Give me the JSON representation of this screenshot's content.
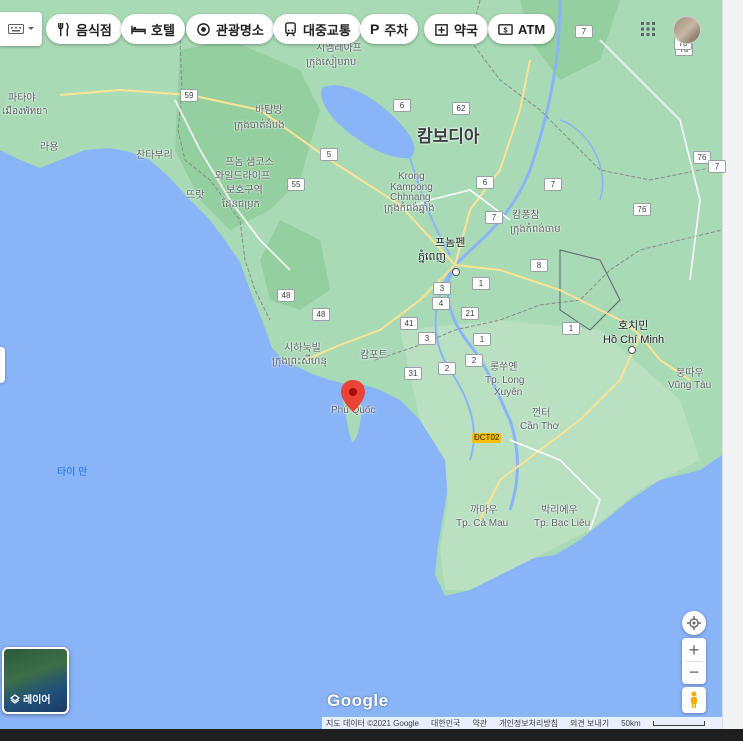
{
  "chips": [
    {
      "label": "음식점",
      "icon": "fork-knife-icon"
    },
    {
      "label": "호텔",
      "icon": "bed-icon"
    },
    {
      "label": "관광명소",
      "icon": "camera-icon"
    },
    {
      "label": "대중교통",
      "icon": "train-icon"
    },
    {
      "label": "주차",
      "icon": "parking-icon"
    },
    {
      "label": "약국",
      "icon": "pharmacy-icon"
    },
    {
      "label": "ATM",
      "icon": "atm-icon"
    }
  ],
  "map_labels": {
    "country": "캄보디아",
    "siem_reap_ko": "시엠레아프",
    "siem_reap_km": "ក្រុងសៀមរាប",
    "pattaya_ko": "파타야",
    "pattaya_th": "เมืองพัทยา",
    "rayong": "라용",
    "chanthaburi": "찬타부리",
    "trat": "뜨랏",
    "battambang_ko": "바탐방",
    "battambang_km": "ក្រុងបាត់ដំបង",
    "phnom_samkos_1": "프놈 샘코스",
    "phnom_samkos_2": "와일드라이프",
    "phnom_samkos_3": "보호구역",
    "phnom_samkos_km": "ដែនជម្រក",
    "kampong_chhnang_1": "Krong",
    "kampong_chhnang_2": "Kampong",
    "kampong_chhnang_3": "Chhnang",
    "kampong_chhnang_km": "ក្រុងកំពង់ឆ្នាំង",
    "kampong_cham_ko": "캄퐁참",
    "kampong_cham_km": "ក្រុងកំពង់ចាម",
    "phnom_penh_ko": "프놈펜",
    "phnom_penh_km": "ភ្នំពេញ",
    "sihanoukville_ko": "시하눅빌",
    "sihanoukville_km": "ក្រុងព្រះសីហនុ",
    "kampot": "캄포트",
    "hcmc_ko": "호치민",
    "hcmc_vi": "Hồ Chí Minh",
    "vung_tau_ko": "붕따우",
    "vung_tau_vi": "Vũng Tàu",
    "long_xuyen_ko": "롱쑤옌",
    "long_xuyen_vi_1": "Tp. Long",
    "long_xuyen_vi_2": "Xuyên",
    "can_tho_ko": "껀터",
    "can_tho_vi": "Cần Thơ",
    "ca_mau_ko": "까마우",
    "ca_mau_vi": "Tp. Cà Mau",
    "bac_lieu_ko": "박리에우",
    "bac_lieu_vi": "Tp. Bạc Liêu",
    "phu_quoc": "Phú Quốc",
    "gulf_thailand": "타이 만"
  },
  "shields": [
    "7",
    "78",
    "59",
    "6",
    "62",
    "5",
    "55",
    "6",
    "7",
    "76",
    "76",
    "7",
    "8",
    "3",
    "1",
    "48",
    "4",
    "21",
    "1",
    "41",
    "3",
    "2",
    "31",
    "2",
    "1",
    "48",
    "78",
    "7"
  ],
  "layers_label": "레이어",
  "google_logo": "Google",
  "footer": {
    "map_data": "지도 데이터 ©2021 Google",
    "region": "대한민국",
    "terms": "약관",
    "privacy": "개인정보처리방침",
    "feedback": "의견 보내기",
    "scale": "50km"
  },
  "road_badge": "ĐCT02",
  "colors": {
    "water": "#8ab4f8",
    "land": "#a8dab5",
    "land_dark": "#94d2a5",
    "highland": "#c8e6c9",
    "marker": "#ea4335"
  }
}
